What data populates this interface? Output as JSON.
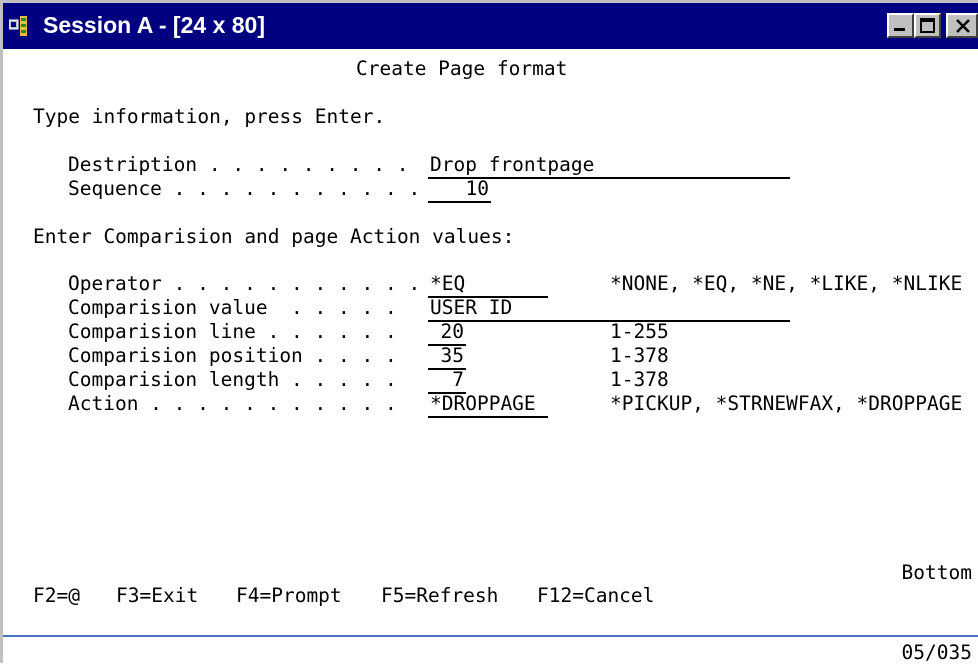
{
  "window": {
    "title": "Session A - [24 x 80]",
    "icon": "session-icon",
    "buttons": [
      "minimize-icon",
      "maximize-icon",
      "close-icon"
    ]
  },
  "screen": {
    "title": "Create Page format",
    "instruction": "Type information, press Enter.",
    "description": {
      "label": "Destription . . . . . . . . .",
      "value": "Drop frontpage"
    },
    "sequence": {
      "label": "Sequence . . . . . . . . . . .",
      "value": "10"
    },
    "section_heading": "Enter Comparision and page Action values:",
    "fields": [
      {
        "label": "Operator . . . . . . . . . . .",
        "value": "*EQ",
        "hint": "*NONE, *EQ, *NE, *LIKE, *NLIKE"
      },
      {
        "label": "Comparision value  . . . . .",
        "value": "USER ID",
        "hint": ""
      },
      {
        "label": "Comparision line . . . . . .",
        "value": "20",
        "hint": "1-255"
      },
      {
        "label": "Comparision position . . . .",
        "value": "35",
        "hint": "1-378"
      },
      {
        "label": "Comparision length . . . . .",
        "value": "7",
        "hint": "1-378"
      },
      {
        "label": "Action . . . . . . . . . . .",
        "value": "*DROPPAGE",
        "hint": "*PICKUP, *STRNEWFAX, *DROPPAGE"
      }
    ],
    "bottom_label": "Bottom",
    "function_keys": [
      "F2=@",
      "F3=Exit",
      "F4=Prompt",
      "F5=Refresh",
      "F12=Cancel"
    ],
    "status": "05/035"
  },
  "colors": {
    "titlebar": "#000080",
    "divider": "#4a74c9",
    "chrome": "#c0c0c0"
  }
}
